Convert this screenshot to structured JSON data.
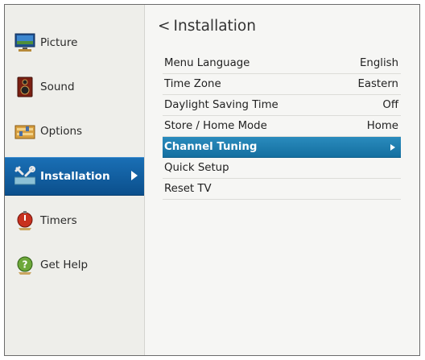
{
  "sidebar": {
    "items": [
      {
        "label": "Picture",
        "icon": "picture-icon"
      },
      {
        "label": "Sound",
        "icon": "speaker-icon"
      },
      {
        "label": "Options",
        "icon": "options-icon"
      },
      {
        "label": "Installation",
        "icon": "tools-icon",
        "active": true
      },
      {
        "label": "Timers",
        "icon": "timer-icon"
      },
      {
        "label": "Get Help",
        "icon": "help-icon"
      }
    ]
  },
  "main": {
    "title_chevron": "<",
    "title": "Installation",
    "rows": [
      {
        "label": "Menu Language",
        "value": "English"
      },
      {
        "label": "Time Zone",
        "value": "Eastern"
      },
      {
        "label": "Daylight Saving Time",
        "value": "Off"
      },
      {
        "label": "Store / Home Mode",
        "value": "Home"
      },
      {
        "label": "Channel Tuning",
        "value": "",
        "selected": true
      },
      {
        "label": "Quick Setup",
        "value": ""
      },
      {
        "label": "Reset TV",
        "value": ""
      }
    ]
  },
  "colors": {
    "active_sidebar": "#1264a6",
    "selected_row": "#1f7fb2"
  }
}
